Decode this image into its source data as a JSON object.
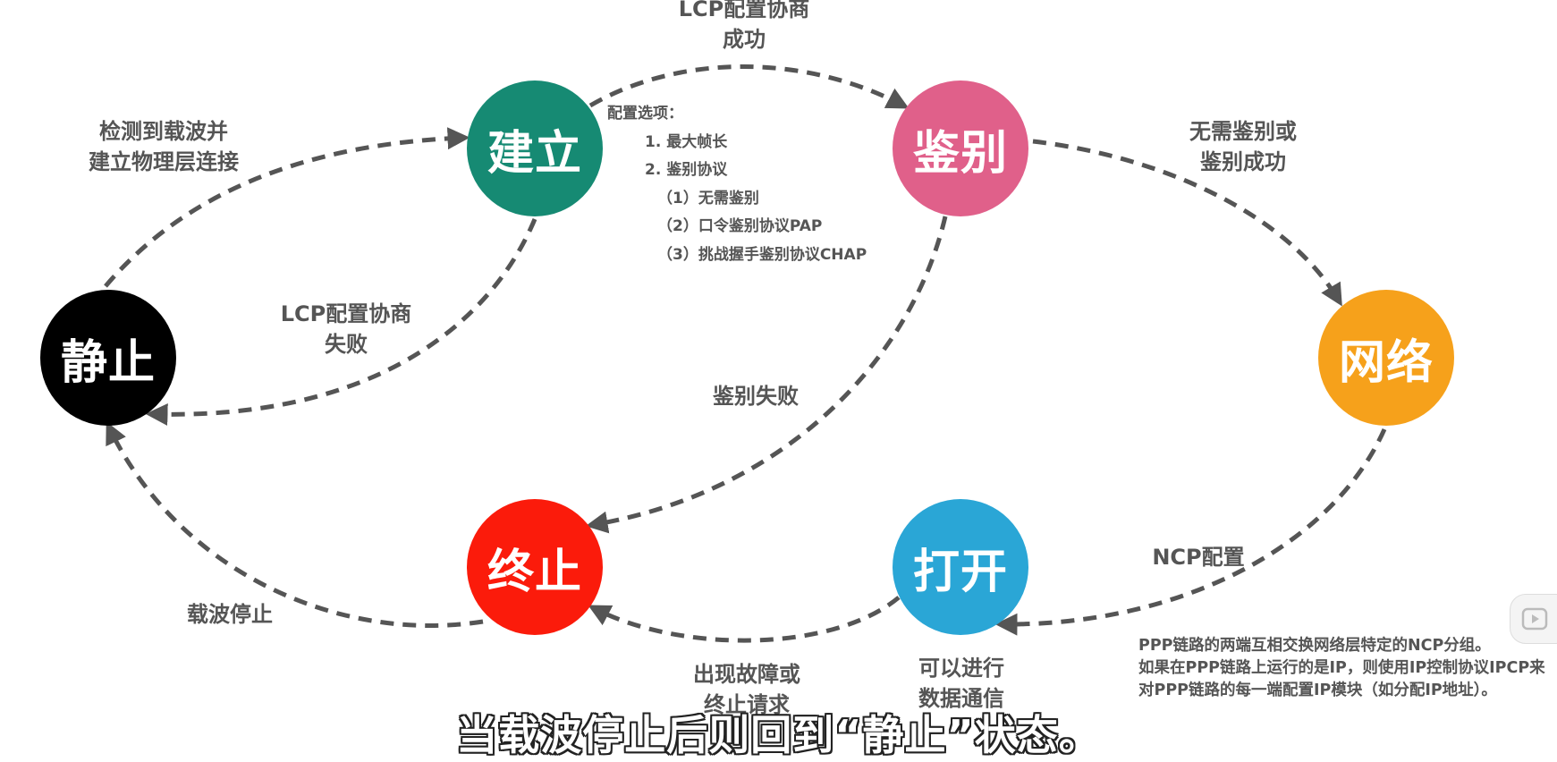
{
  "nodes": {
    "static": {
      "label": "静止",
      "color": "#000000"
    },
    "establish": {
      "label": "建立",
      "color": "#168a73"
    },
    "authenticate": {
      "label": "鉴别",
      "color": "#e0608a"
    },
    "network": {
      "label": "网络",
      "color": "#f6a11b"
    },
    "open": {
      "label": "打开",
      "color": "#2aa6d6"
    },
    "terminate": {
      "label": "终止",
      "color": "#fb1b0b"
    }
  },
  "edges": {
    "static_to_establish": {
      "line1": "检测到载波并",
      "line2": "建立物理层连接"
    },
    "establish_to_authenticate": {
      "line1": "LCP配置协商",
      "line2": "成功"
    },
    "establish_to_static": {
      "line1": "LCP配置协商",
      "line2": "失败"
    },
    "authenticate_to_network": {
      "line1": "无需鉴别或",
      "line2": "鉴别成功"
    },
    "authenticate_to_terminate": {
      "line1": "鉴别失败"
    },
    "network_to_open": {
      "line1": "NCP配置"
    },
    "open_to_terminate": {
      "line1": "出现故障或",
      "line2": "终止请求"
    },
    "terminate_to_static": {
      "line1": "载波停止"
    },
    "open_note": {
      "line1": "可以进行",
      "line2": "数据通信"
    }
  },
  "config_options": {
    "title": "配置选项：",
    "items": [
      "1. 最大帧长",
      "2. 鉴别协议",
      "（1）无需鉴别",
      "（2）口令鉴别协议PAP",
      "（3）挑战握手鉴别协议CHAP"
    ]
  },
  "ncp_note": {
    "lines": [
      "PPP链路的两端互相交换网络层特定的NCP分组。",
      "如果在PPP链路上运行的是IP，则使用IP控制协议IPCP来",
      "对PPP链路的每一端配置IP模块（如分配IP地址）。"
    ]
  },
  "subtitle": "当载波停止后则回到“静止”状态。",
  "colors": {
    "arrow": "#555555",
    "label": "#555555"
  }
}
